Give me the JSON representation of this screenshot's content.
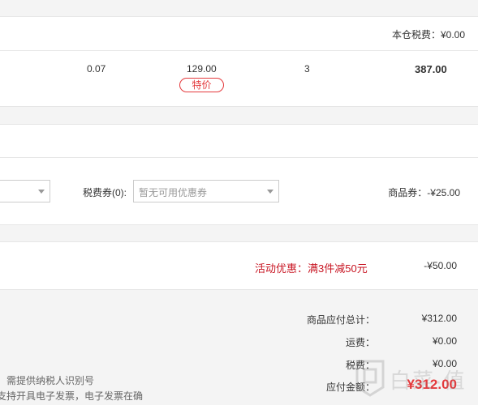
{
  "warehouse": {
    "tax_label": "本仓税费：",
    "tax_value": "¥0.00"
  },
  "item": {
    "tax_rate": "0.07",
    "unit_price": "129.00",
    "price_badge": "特价",
    "quantity": "3",
    "subtotal": "387.00"
  },
  "coupons": {
    "tax_coupon_label": "税费券(0):",
    "tax_coupon_placeholder": "暂无可用优惠券",
    "goods_coupon_label": "商品券：",
    "goods_coupon_value": "-¥25.00"
  },
  "promotion": {
    "label": "活动优惠：满3件减50元",
    "value": "-¥50.00"
  },
  "invoice_notes": {
    "line1": "）需提供纳税人识别号",
    "line2": "支持开具电子发票，电子发票在确"
  },
  "summary": {
    "goods_total_label": "商品应付总计：",
    "goods_total_value": "¥312.00",
    "shipping_label": "运费：",
    "shipping_value": "¥0.00",
    "tax_label": "税费：",
    "tax_value": "¥0.00",
    "payable_label": "应付金额：",
    "payable_value": "¥312.00"
  },
  "watermark": {
    "text": "白菜·值"
  },
  "colors": {
    "accent_red": "#e4393c",
    "promo_red": "#c81623"
  }
}
